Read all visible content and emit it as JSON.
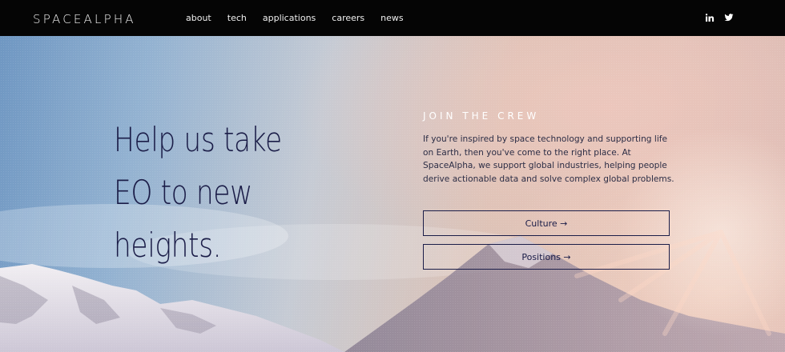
{
  "header": {
    "logo": "SPACEALPHA",
    "nav": [
      "about",
      "tech",
      "applications",
      "careers",
      "news"
    ],
    "social": [
      {
        "icon": "linkedin-icon",
        "label": "in"
      },
      {
        "icon": "twitter-icon"
      }
    ]
  },
  "hero": {
    "headline": "Help us take EO to new heights.",
    "section_label": "JOIN THE CREW",
    "body": "If you're inspired by space technology and supporting life on Earth, then you've come to the right place. At SpaceAlpha, we support global industries, helping people derive actionable data and solve complex global problems.",
    "buttons": {
      "culture": "Culture →",
      "positions": "Positions →"
    }
  },
  "colors": {
    "navbar_bg": "#050505",
    "headline": "#1b1d48",
    "accent_border": "#1b1d48"
  }
}
